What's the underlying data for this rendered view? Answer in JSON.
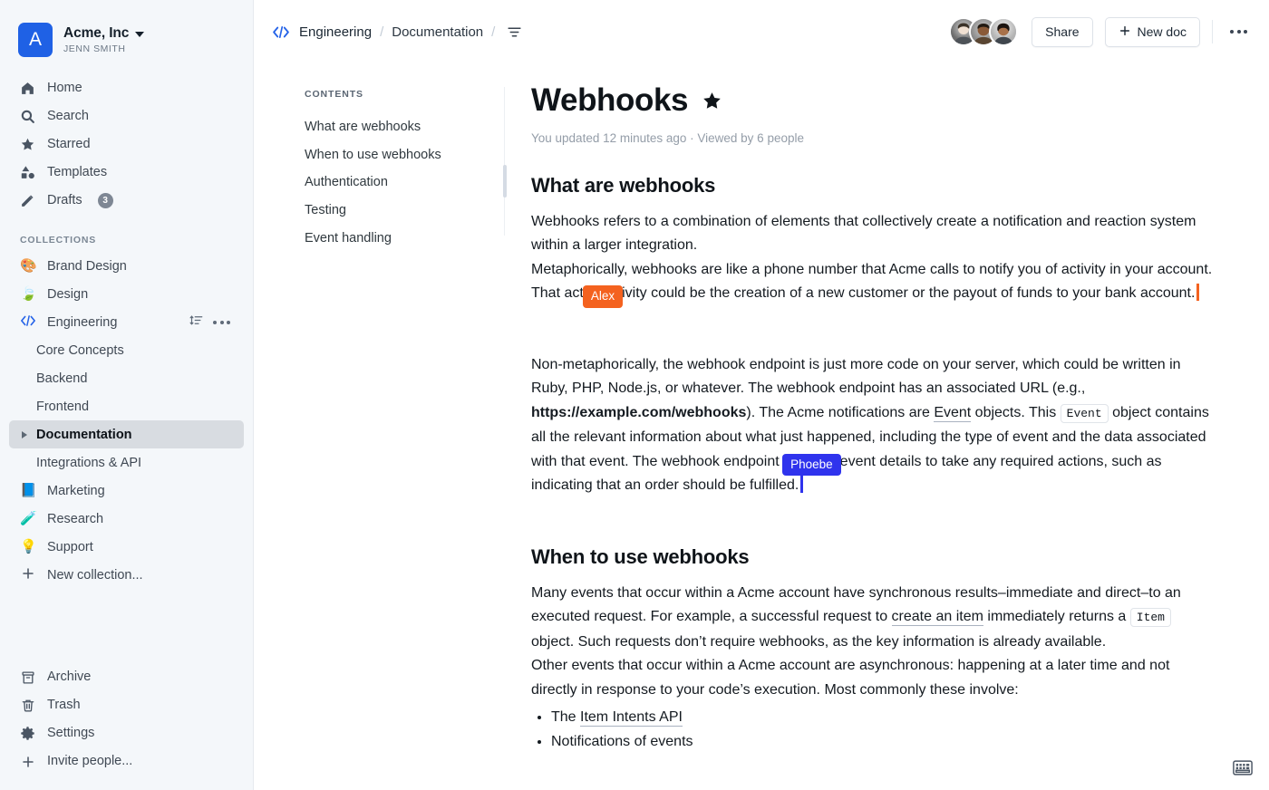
{
  "sidebar": {
    "team": {
      "name": "Acme, Inc",
      "user": "JENN SMITH",
      "logo_letter": "A",
      "logo_color": "#1f61e5"
    },
    "nav_top": [
      {
        "label": "Home",
        "icon": "home-icon"
      },
      {
        "label": "Search",
        "icon": "search-icon"
      },
      {
        "label": "Starred",
        "icon": "star-icon"
      },
      {
        "label": "Templates",
        "icon": "templates-icon"
      },
      {
        "label": "Drafts",
        "icon": "pencil-icon",
        "count": "3"
      }
    ],
    "collections_heading": "COLLECTIONS",
    "collections": [
      {
        "label": "Brand Design",
        "emoji": "🎨"
      },
      {
        "label": "Design",
        "emoji": "🍃"
      },
      {
        "label": "Engineering",
        "emoji": "code",
        "has_actions": true
      },
      {
        "label": "Marketing",
        "emoji": "📘"
      },
      {
        "label": "Research",
        "emoji": "🧪"
      },
      {
        "label": "Support",
        "emoji": "💡"
      }
    ],
    "engineering_docs": [
      {
        "label": "Core Concepts",
        "active": false
      },
      {
        "label": "Backend",
        "active": false
      },
      {
        "label": "Frontend",
        "active": false
      },
      {
        "label": "Documentation",
        "active": true
      },
      {
        "label": "Integrations & API",
        "active": false
      }
    ],
    "new_collection_label": "New collection...",
    "nav_bottom": [
      {
        "label": "Archive",
        "icon": "archive-icon"
      },
      {
        "label": "Trash",
        "icon": "trash-icon"
      },
      {
        "label": "Settings",
        "icon": "gear-icon"
      },
      {
        "label": "Invite people...",
        "icon": "plus-icon"
      }
    ]
  },
  "topbar": {
    "breadcrumb": [
      "Engineering",
      "Documentation"
    ],
    "separator": "/",
    "menu_icon": "list-menu-icon",
    "share_label": "Share",
    "new_doc_label": "New doc",
    "overflow_icon": "more-horizontal-icon",
    "collaborator_count": 3
  },
  "toc": {
    "heading": "CONTENTS",
    "items": [
      "What are webhooks",
      "When to use webhooks",
      "Authentication",
      "Testing",
      "Event handling"
    ]
  },
  "document": {
    "title": "Webhooks",
    "starred": true,
    "meta": "You updated 12 minutes ago · Viewed by 6 people",
    "sections": [
      {
        "heading": "What are webhooks",
        "p1": "Webhooks refers to a combination of elements that collectively create a notification and reaction system within a larger integration.",
        "p2_a": "Metaphorically, webhooks are like a phone number that Acme calls to notify you of activity in your account. That act",
        "p2_b": "ivity could be the creation of a new customer or the payout of funds to your bank account.",
        "p3_a": "Non-metaphorically, the webhook endpoint is just more code on your server, which could be written in Ruby, PHP, Node.js, or whatever. The webhook endpoint has an associated URL (e.g., ",
        "p3_url": "https://example.com/webhooks",
        "p3_b": "). The Acme notifications are ",
        "p3_link": "Event",
        "p3_c": " objects. This ",
        "p3_code": "Event",
        "p3_d": " object contains all the relevant information about what just happened, including the type of event and the data associated with that event. The webhook endpoint ",
        "p3_e": "event details to take any required actions, such as indicating that an order should be fulfilled."
      },
      {
        "heading": "When to use webhooks",
        "p1_a": "Many events that occur within a Acme account have synchronous results–immediate and direct–to an executed request. For example, a successful request to ",
        "p1_link": "create an item",
        "p1_b": " immediately returns a ",
        "p1_code": "Item",
        "p1_c": " object. Such requests don’t require webhooks, as the key information is already available.",
        "p2_a": "Other events that occur within a Acme account are asynchronous: happening at a later time and not directly in response to your code’s execution. Most commonly these involve:",
        "bullets": [
          {
            "prefix": "The ",
            "link": "Item Intents API",
            "suffix": ""
          },
          {
            "prefix": "Notifications of events",
            "link": "",
            "suffix": ""
          }
        ]
      }
    ]
  },
  "cursors": [
    {
      "name": "Alex",
      "color": "#f4621f"
    },
    {
      "name": "Phoebe",
      "color": "#2f33ed"
    }
  ],
  "footer": {
    "keyboard_icon": "keyboard-icon"
  }
}
